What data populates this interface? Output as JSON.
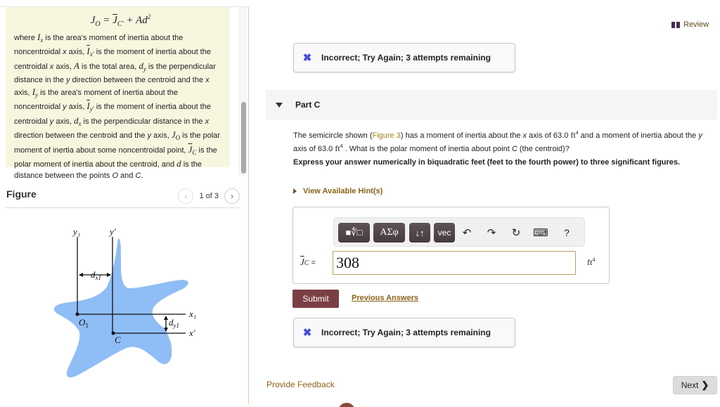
{
  "left": {
    "formula": {
      "lhs": "J",
      "lhs_sub": "O",
      "eq": " = ",
      "jbar": "J",
      "jbar_sub": "C′",
      "plus": " + Ad",
      "exp": "2"
    },
    "note_segments": [
      "where ",
      "I",
      "x",
      " is the area's moment of inertia about the noncentroidal ",
      "x",
      " axis, ",
      "I",
      "x′",
      " is the moment of inertia about the centroidal ",
      "x",
      " axis, ",
      "A",
      " is the total area, ",
      "d",
      "y",
      " is the perpendicular distance in the ",
      "y",
      " direction between the centroid and the ",
      "x",
      " axis, ",
      "I",
      "y",
      " is the area's moment of inertia about the noncentroidal ",
      "y",
      " axis, ",
      "I",
      "y′",
      " is the moment of inertia about the centroidal ",
      "y",
      " axis, ",
      "d",
      "x",
      " is the perpendicular distance in the ",
      "x",
      " direction between the centroid and the ",
      "y",
      " axis, ",
      "J",
      "O",
      " is the polar moment of inertia about some noncentroidal point, ",
      "J",
      "C",
      " is the polar moment of inertia about the centroid, and ",
      "d",
      " is the distance between the points ",
      "O",
      " and ",
      "C",
      "."
    ],
    "figure": {
      "title": "Figure",
      "pager_text": "1 of 3",
      "prev_icon": "‹",
      "next_icon": "›",
      "labels": {
        "y1": "y₁",
        "yprime": "y′",
        "dx1": "d",
        "dx1_sub": "x1",
        "x1": "x₁",
        "xprime": "x′",
        "dy1": "d",
        "dy1_sub": "y1",
        "o1": "O",
        "o1_sub": "1",
        "c": "C"
      },
      "shape_color": "#8fbdf5"
    }
  },
  "right": {
    "review_label": "Review",
    "feedback_top": "Incorrect; Try Again; 3 attempts remaining",
    "part_title": "Part C",
    "question": {
      "p1": "The semicircle shown (",
      "fig_link": "Figure 3",
      "p2": ") has a moment of inertia about the ",
      "x": "x",
      "p3": " axis of 63.0 ",
      "unit": "ft",
      "exp": "4",
      "p4": " and a moment of inertia about the ",
      "y": "y",
      "p5": " axis of 63.0 ",
      "p6": " . What is the polar moment of inertia about point ",
      "c": "C",
      "p7": " (the centroid)?"
    },
    "instruction": "Express your answer numerically in biquadratic feet (feet to the fourth power) to three significant figures.",
    "hints_label": "View Available Hint(s)",
    "toolbar": {
      "templates": "■∜□",
      "greek": "ΑΣφ",
      "arrows": "↓↑",
      "vec": "vec",
      "undo": "↶",
      "redo": "↷",
      "reset": "↻",
      "keyboard": "⌨",
      "help": "?"
    },
    "answer": {
      "label_j": "J",
      "label_sub": "C",
      "label_eq": " =",
      "value": "308",
      "unit": "ft",
      "unit_exp": "4"
    },
    "submit_label": "Submit",
    "previous_answers_label": "Previous Answers",
    "feedback_bottom": "Incorrect; Try Again; 3 attempts remaining",
    "provide_feedback_label": "Provide Feedback",
    "next_label": "Next",
    "next_icon": "❯",
    "x_icon": "✖",
    "colors": {
      "accent_link": "#8a6318",
      "submit_bg": "#7a3f44",
      "x_icon": "#4b4fde",
      "note_bg": "#f7f7e0"
    }
  }
}
